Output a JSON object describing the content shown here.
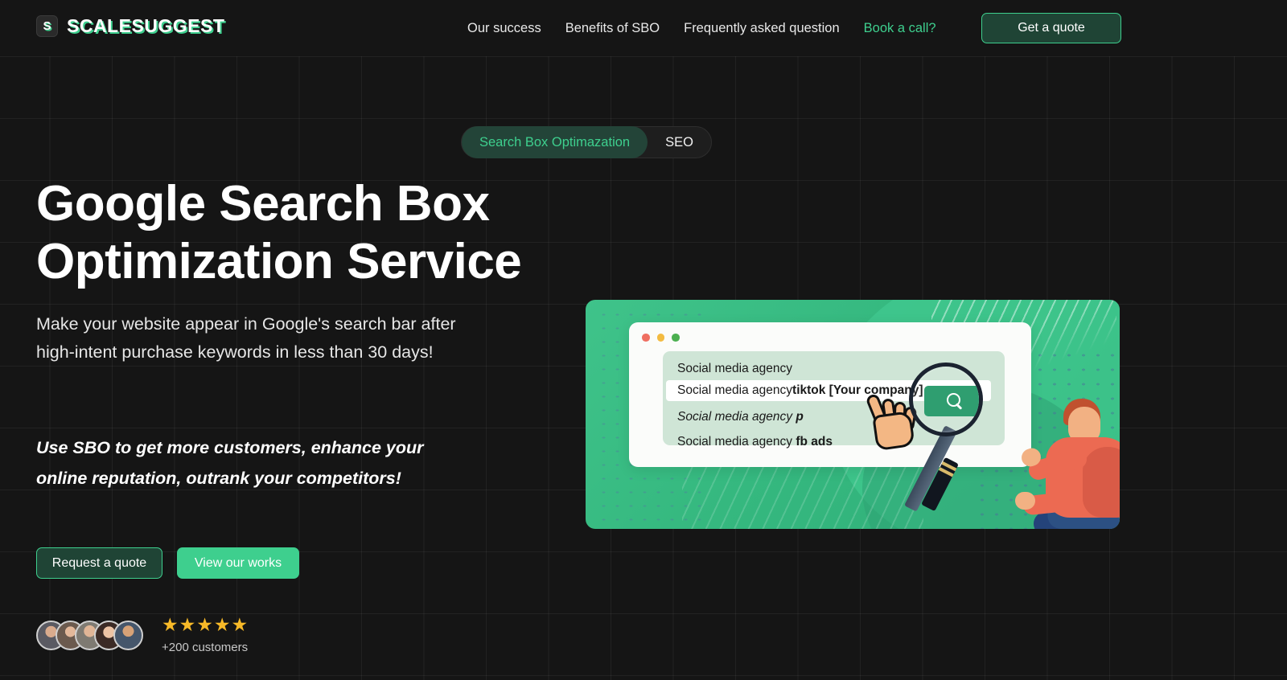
{
  "brand": {
    "mark": "S",
    "name": "SCALESUGGEST"
  },
  "nav": {
    "items": [
      {
        "label": "Our success",
        "accent": false
      },
      {
        "label": "Benefits of SBO",
        "accent": false
      },
      {
        "label": "Frequently asked question",
        "accent": false
      },
      {
        "label": "Book a call?",
        "accent": true
      }
    ],
    "cta_label": "Get a quote"
  },
  "toggle": {
    "active_label": "Search Box Optimazation",
    "inactive_label": "SEO"
  },
  "hero": {
    "title_line1": "Google Search Box",
    "title_line2": "Optimization Service",
    "subtitle": "Make your website appear in Google's search bar after high-intent purchase keywords in less than 30 days!",
    "emphasis": "Use SBO to get more customers, enhance your online reputation, outrank your competitors!",
    "primary_cta": "Request a quote",
    "secondary_cta": "View our works"
  },
  "social_proof": {
    "stars": "★★★★★",
    "rating_count": 5,
    "customers_label": "+200 customers",
    "avatar_count": 5
  },
  "illustration": {
    "traffic_lights": [
      "red",
      "yellow",
      "green"
    ],
    "suggestions": [
      {
        "base": "Social media agency",
        "bold": "",
        "style": "normal",
        "highlighted": false
      },
      {
        "base": "Social media agency ",
        "bold": "tiktok [Your company]",
        "style": "normal",
        "highlighted": true
      },
      {
        "base": "Social media agency ",
        "bold": "p",
        "style": "italic",
        "highlighted": false
      },
      {
        "base": "Social media agency ",
        "bold": "fb ads",
        "style": "normal",
        "highlighted": false
      }
    ],
    "search_icon": "magnifier-icon"
  },
  "colors": {
    "background": "#151515",
    "accent_green": "#3ecf8e",
    "dark_green": "#1f4435",
    "illustration_green": "#35b87f",
    "star_gold": "#f7b928"
  }
}
